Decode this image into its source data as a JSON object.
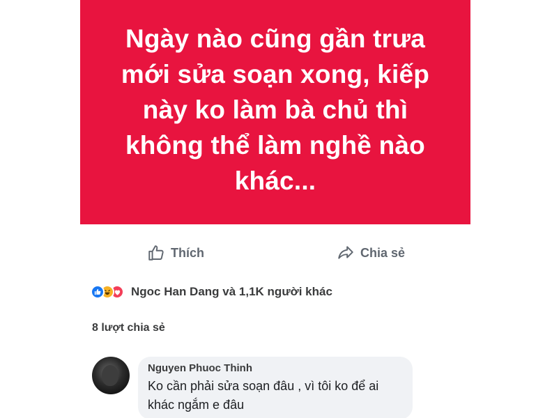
{
  "post": {
    "background_color": "#e8143f",
    "text": "Ngày nào cũng gần trưa mới sửa soạn xong, kiếp này ko làm bà chủ thì không thể làm nghề nào khác..."
  },
  "actions": {
    "like_label": "Thích",
    "share_label": "Chia sẻ"
  },
  "reactions": {
    "icons": [
      "like-icon",
      "haha-icon",
      "love-icon"
    ],
    "text": "Ngoc Han Dang và 1,1K người khác"
  },
  "shares": {
    "text": "8 lượt chia sẻ"
  },
  "comment": {
    "author": "Nguyen Phuoc Thinh",
    "text": "Ko cần phải sửa soạn đâu , vì tôi ko để ai khác ngắm e đâu"
  }
}
